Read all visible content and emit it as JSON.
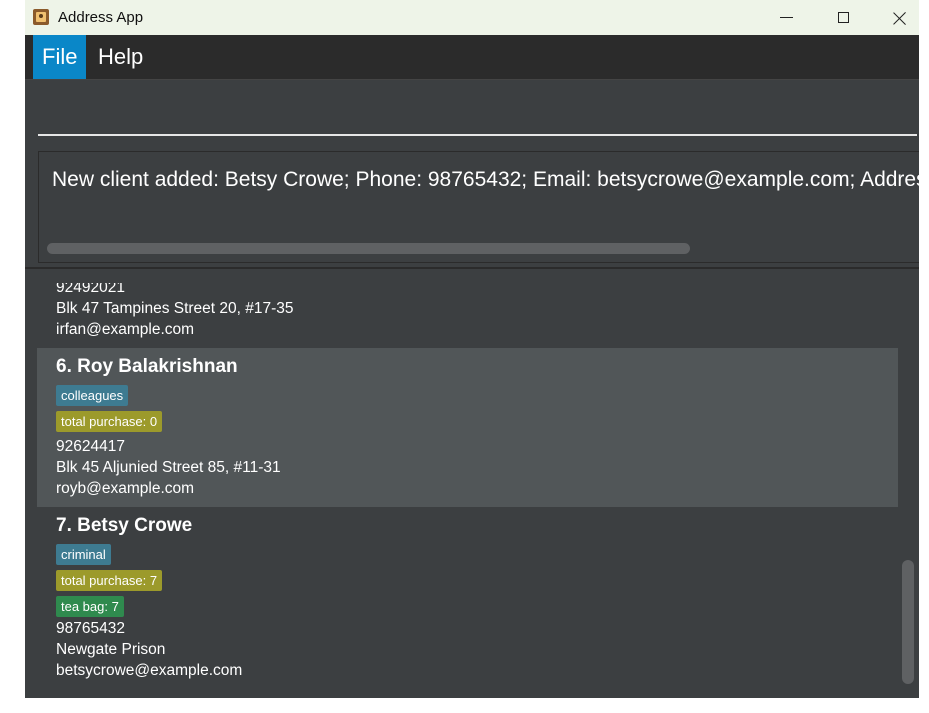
{
  "window": {
    "title": "Address App"
  },
  "menu": {
    "items": [
      "File",
      "Help"
    ]
  },
  "command": {
    "value": ""
  },
  "result": {
    "text": "New client added: Betsy Crowe; Phone: 98765432; Email: betsycrowe@example.com; Address: Newgate Prison"
  },
  "persons": [
    {
      "phone": "92492021",
      "address": "Blk 47 Tampines Street 20, #17-35",
      "email": "irfan@example.com"
    },
    {
      "name": "6. Roy Balakrishnan",
      "tags": [
        {
          "label": "colleagues",
          "color": "#3e7b91"
        },
        {
          "label": "total purchase: 0",
          "color": "#9c9a2b"
        }
      ],
      "phone": "92624417",
      "address": "Blk 45 Aljunied Street 85, #11-31",
      "email": "royb@example.com"
    },
    {
      "name": "7. Betsy Crowe",
      "tags": [
        {
          "label": "criminal",
          "color": "#3e7b91"
        },
        {
          "label": "total purchase: 7",
          "color": "#9c9a2b"
        },
        {
          "label": "tea bag: 7",
          "color": "#2f8a4e"
        }
      ],
      "phone": "98765432",
      "address": "Newgate Prison",
      "email": "betsycrowe@example.com"
    }
  ],
  "colors": {
    "accent": "#0a87c8",
    "background": "#3c3f41",
    "selected": "#515658",
    "menubar": "#2b2b2b"
  }
}
